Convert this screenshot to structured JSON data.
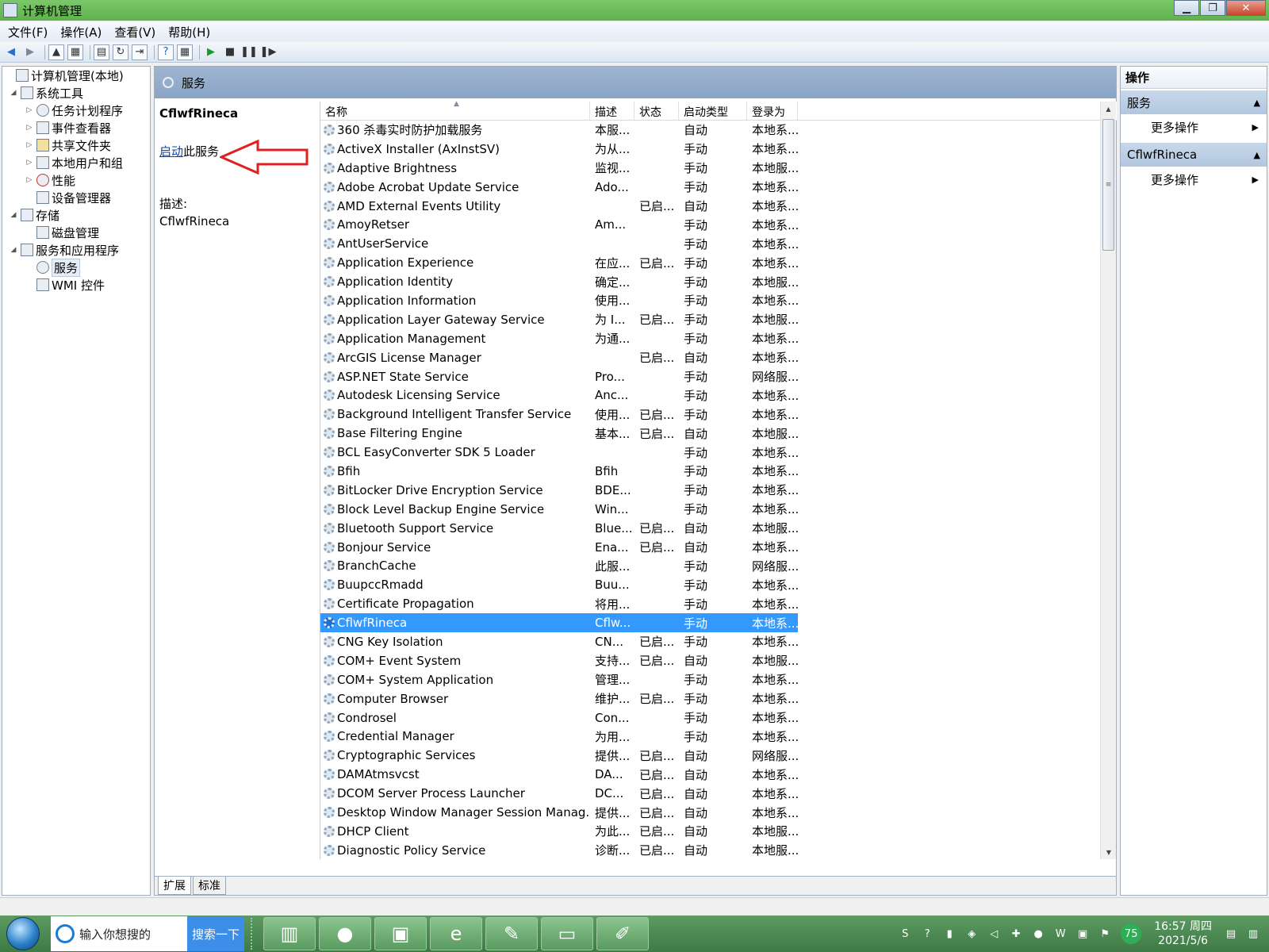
{
  "window": {
    "title": "计算机管理"
  },
  "menu": [
    "文件(F)",
    "操作(A)",
    "查看(V)",
    "帮助(H)"
  ],
  "tree": [
    {
      "label": "计算机管理(本地)",
      "level": 0,
      "arrow": ""
    },
    {
      "label": "系统工具",
      "level": 1,
      "arrow": "◢"
    },
    {
      "label": "任务计划程序",
      "level": 2,
      "arrow": "▷"
    },
    {
      "label": "事件查看器",
      "level": 2,
      "arrow": "▷"
    },
    {
      "label": "共享文件夹",
      "level": 2,
      "arrow": "▷"
    },
    {
      "label": "本地用户和组",
      "level": 2,
      "arrow": "▷"
    },
    {
      "label": "性能",
      "level": 2,
      "arrow": "▷"
    },
    {
      "label": "设备管理器",
      "level": 2,
      "arrow": ""
    },
    {
      "label": "存储",
      "level": 1,
      "arrow": "◢"
    },
    {
      "label": "磁盘管理",
      "level": 2,
      "arrow": ""
    },
    {
      "label": "服务和应用程序",
      "level": 1,
      "arrow": "◢"
    },
    {
      "label": "服务",
      "level": 2,
      "arrow": "",
      "selected": true
    },
    {
      "label": "WMI 控件",
      "level": 2,
      "arrow": ""
    }
  ],
  "center": {
    "header": "服务",
    "detail": {
      "service_name": "CflwfRineca",
      "start_link": "启动",
      "start_suffix": "此服务",
      "desc_label": "描述:",
      "desc_text": "CflwfRineca"
    },
    "columns": {
      "name": "名称",
      "desc": "描述",
      "status": "状态",
      "start_type": "启动类型",
      "logon": "登录为"
    },
    "services": [
      {
        "name": "360 杀毒实时防护加载服务",
        "desc": "本服...",
        "status": "",
        "type": "自动",
        "logon": "本地系..."
      },
      {
        "name": "ActiveX Installer (AxInstSV)",
        "desc": "为从...",
        "status": "",
        "type": "手动",
        "logon": "本地系..."
      },
      {
        "name": "Adaptive Brightness",
        "desc": "监视...",
        "status": "",
        "type": "手动",
        "logon": "本地服..."
      },
      {
        "name": "Adobe Acrobat Update Service",
        "desc": "Ado...",
        "status": "",
        "type": "手动",
        "logon": "本地系..."
      },
      {
        "name": "AMD External Events Utility",
        "desc": "",
        "status": "已启...",
        "type": "自动",
        "logon": "本地系..."
      },
      {
        "name": "AmoyRetser",
        "desc": "Am...",
        "status": "",
        "type": "手动",
        "logon": "本地系..."
      },
      {
        "name": "AntUserService",
        "desc": "",
        "status": "",
        "type": "手动",
        "logon": "本地系..."
      },
      {
        "name": "Application Experience",
        "desc": "在应...",
        "status": "已启...",
        "type": "手动",
        "logon": "本地系..."
      },
      {
        "name": "Application Identity",
        "desc": "确定...",
        "status": "",
        "type": "手动",
        "logon": "本地服..."
      },
      {
        "name": "Application Information",
        "desc": "使用...",
        "status": "",
        "type": "手动",
        "logon": "本地系..."
      },
      {
        "name": "Application Layer Gateway Service",
        "desc": "为 I...",
        "status": "已启...",
        "type": "手动",
        "logon": "本地服..."
      },
      {
        "name": "Application Management",
        "desc": "为通...",
        "status": "",
        "type": "手动",
        "logon": "本地系..."
      },
      {
        "name": "ArcGIS License Manager",
        "desc": "",
        "status": "已启...",
        "type": "自动",
        "logon": "本地系..."
      },
      {
        "name": "ASP.NET State Service",
        "desc": "Pro...",
        "status": "",
        "type": "手动",
        "logon": "网络服..."
      },
      {
        "name": "Autodesk Licensing Service",
        "desc": "Anc...",
        "status": "",
        "type": "手动",
        "logon": "本地系..."
      },
      {
        "name": "Background Intelligent Transfer Service",
        "desc": "使用...",
        "status": "已启...",
        "type": "手动",
        "logon": "本地系..."
      },
      {
        "name": "Base Filtering Engine",
        "desc": "基本...",
        "status": "已启...",
        "type": "自动",
        "logon": "本地服..."
      },
      {
        "name": "BCL EasyConverter SDK 5 Loader",
        "desc": "",
        "status": "",
        "type": "手动",
        "logon": "本地系..."
      },
      {
        "name": "Bfih",
        "desc": "Bfih",
        "status": "",
        "type": "手动",
        "logon": "本地系..."
      },
      {
        "name": "BitLocker Drive Encryption Service",
        "desc": "BDE...",
        "status": "",
        "type": "手动",
        "logon": "本地系..."
      },
      {
        "name": "Block Level Backup Engine Service",
        "desc": "Win...",
        "status": "",
        "type": "手动",
        "logon": "本地系..."
      },
      {
        "name": "Bluetooth Support Service",
        "desc": "Blue...",
        "status": "已启...",
        "type": "自动",
        "logon": "本地服..."
      },
      {
        "name": "Bonjour Service",
        "desc": "Ena...",
        "status": "已启...",
        "type": "自动",
        "logon": "本地系..."
      },
      {
        "name": "BranchCache",
        "desc": "此服...",
        "status": "",
        "type": "手动",
        "logon": "网络服..."
      },
      {
        "name": "BuupccRmadd",
        "desc": "Buu...",
        "status": "",
        "type": "手动",
        "logon": "本地系..."
      },
      {
        "name": "Certificate Propagation",
        "desc": "将用...",
        "status": "",
        "type": "手动",
        "logon": "本地系..."
      },
      {
        "name": "CflwfRineca",
        "desc": "Cflw...",
        "status": "",
        "type": "手动",
        "logon": "本地系...",
        "selected": true
      },
      {
        "name": "CNG Key Isolation",
        "desc": "CN...",
        "status": "已启...",
        "type": "手动",
        "logon": "本地系..."
      },
      {
        "name": "COM+ Event System",
        "desc": "支持...",
        "status": "已启...",
        "type": "自动",
        "logon": "本地服..."
      },
      {
        "name": "COM+ System Application",
        "desc": "管理...",
        "status": "",
        "type": "手动",
        "logon": "本地系..."
      },
      {
        "name": "Computer Browser",
        "desc": "维护...",
        "status": "已启...",
        "type": "手动",
        "logon": "本地系..."
      },
      {
        "name": "Condrosel",
        "desc": "Con...",
        "status": "",
        "type": "手动",
        "logon": "本地系..."
      },
      {
        "name": "Credential Manager",
        "desc": "为用...",
        "status": "",
        "type": "手动",
        "logon": "本地系..."
      },
      {
        "name": "Cryptographic Services",
        "desc": "提供...",
        "status": "已启...",
        "type": "自动",
        "logon": "网络服..."
      },
      {
        "name": "DAMAtmsvcst",
        "desc": "DA...",
        "status": "已启...",
        "type": "自动",
        "logon": "本地系..."
      },
      {
        "name": "DCOM Server Process Launcher",
        "desc": "DC...",
        "status": "已启...",
        "type": "自动",
        "logon": "本地系..."
      },
      {
        "name": "Desktop Window Manager Session Manag...",
        "desc": "提供...",
        "status": "已启...",
        "type": "自动",
        "logon": "本地系..."
      },
      {
        "name": "DHCP Client",
        "desc": "为此...",
        "status": "已启...",
        "type": "自动",
        "logon": "本地服..."
      },
      {
        "name": "Diagnostic Policy Service",
        "desc": "诊断...",
        "status": "已启...",
        "type": "自动",
        "logon": "本地服..."
      }
    ]
  },
  "tabs": [
    "扩展",
    "标准"
  ],
  "actions": {
    "title": "操作",
    "sections": [
      {
        "label": "服务",
        "item": "更多操作"
      },
      {
        "label": "CflwfRineca",
        "item": "更多操作"
      }
    ]
  },
  "taskbar": {
    "search_text": "输入你想搜的",
    "search_button": "搜索一下",
    "battery_badge": "75",
    "time": "16:57 周四",
    "date": "2021/5/6"
  }
}
